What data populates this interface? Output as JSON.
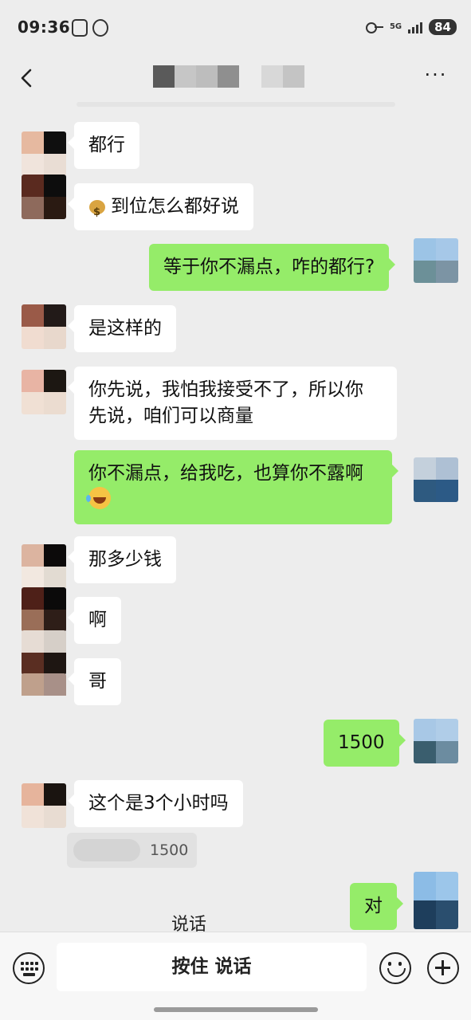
{
  "status_bar": {
    "time": "09:36",
    "network": "5G",
    "battery": "84"
  },
  "nav": {
    "back_icon": "chevron-left-icon",
    "more_label": "···"
  },
  "messages": [
    {
      "side": "in",
      "text": "都行"
    },
    {
      "side": "in",
      "text": "到位怎么都好说",
      "emoji": "money-bag"
    },
    {
      "side": "out",
      "text": "等于你不漏点，咋的都行?"
    },
    {
      "side": "in",
      "text": "是这样的"
    },
    {
      "side": "in",
      "text_line1": "你先说，我怕我接受不了，所以你",
      "text_line2": "先说，咱们可以商量"
    },
    {
      "side": "out",
      "text": "你不漏点，给我吃，也算你不露啊",
      "emoji": "laughing-crying"
    },
    {
      "side": "in",
      "text": "那多少钱"
    },
    {
      "side": "in",
      "text": "啊"
    },
    {
      "side": "in",
      "text": "哥"
    },
    {
      "side": "out",
      "text": "1500"
    },
    {
      "side": "in",
      "text": "这个是3个小时吗"
    },
    {
      "side": "out",
      "text": "对"
    }
  ],
  "quote": {
    "text": "1500"
  },
  "voice_hint": "说话",
  "bottom_bar": {
    "hold_to_talk": "按住 说话",
    "keyboard_icon": "keyboard-icon",
    "emoji_icon": "smile-icon",
    "plus_icon": "plus-icon"
  }
}
